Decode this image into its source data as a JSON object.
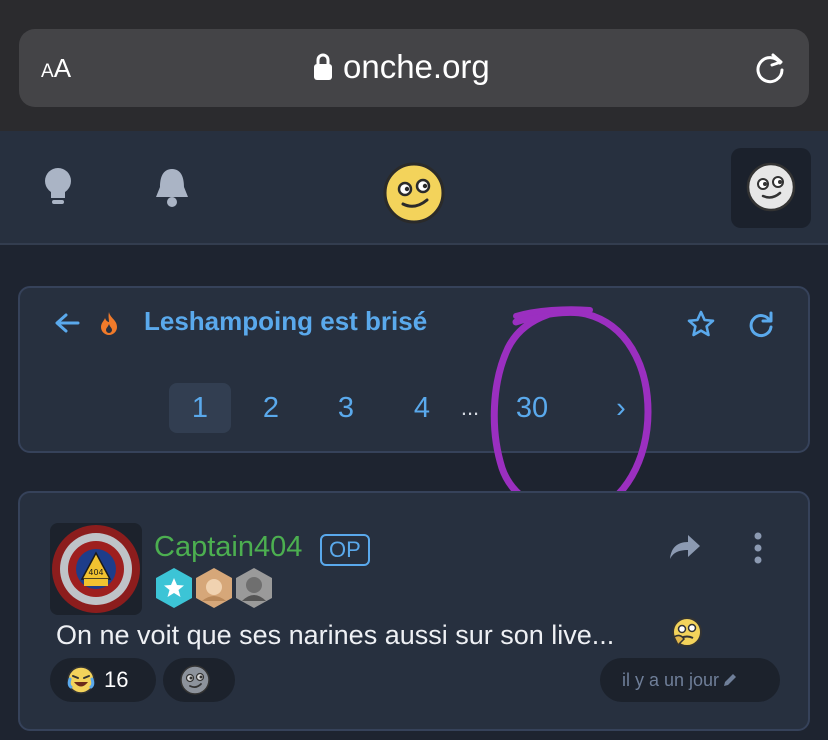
{
  "browser": {
    "text_size_label_small": "A",
    "text_size_label_large": "A",
    "url": "onche.org"
  },
  "nav": {
    "tips_icon": "lightbulb-icon",
    "notifications_icon": "bell-icon",
    "logo_icon": "smiley-logo-icon",
    "profile_icon": "avatar-face-icon"
  },
  "topic": {
    "title": "Leshampoing est brisé",
    "pages": [
      "1",
      "2",
      "3",
      "4"
    ],
    "ellipsis": "...",
    "last_page": "30",
    "next_label": "›",
    "current_page": "1"
  },
  "post": {
    "username": "Captain404",
    "op_label": "OP",
    "text": "On ne voit que ses narines aussi sur son live...",
    "reactions": [
      {
        "emoji": "laughing-crying-emoji",
        "count": "16"
      },
      {
        "emoji": "add-reaction-face-icon",
        "count": ""
      }
    ],
    "time": "il y a un jour",
    "username_color": "#4caf50"
  },
  "colors": {
    "accent": "#5aa9ec",
    "annotation": "#9b2fc0"
  }
}
